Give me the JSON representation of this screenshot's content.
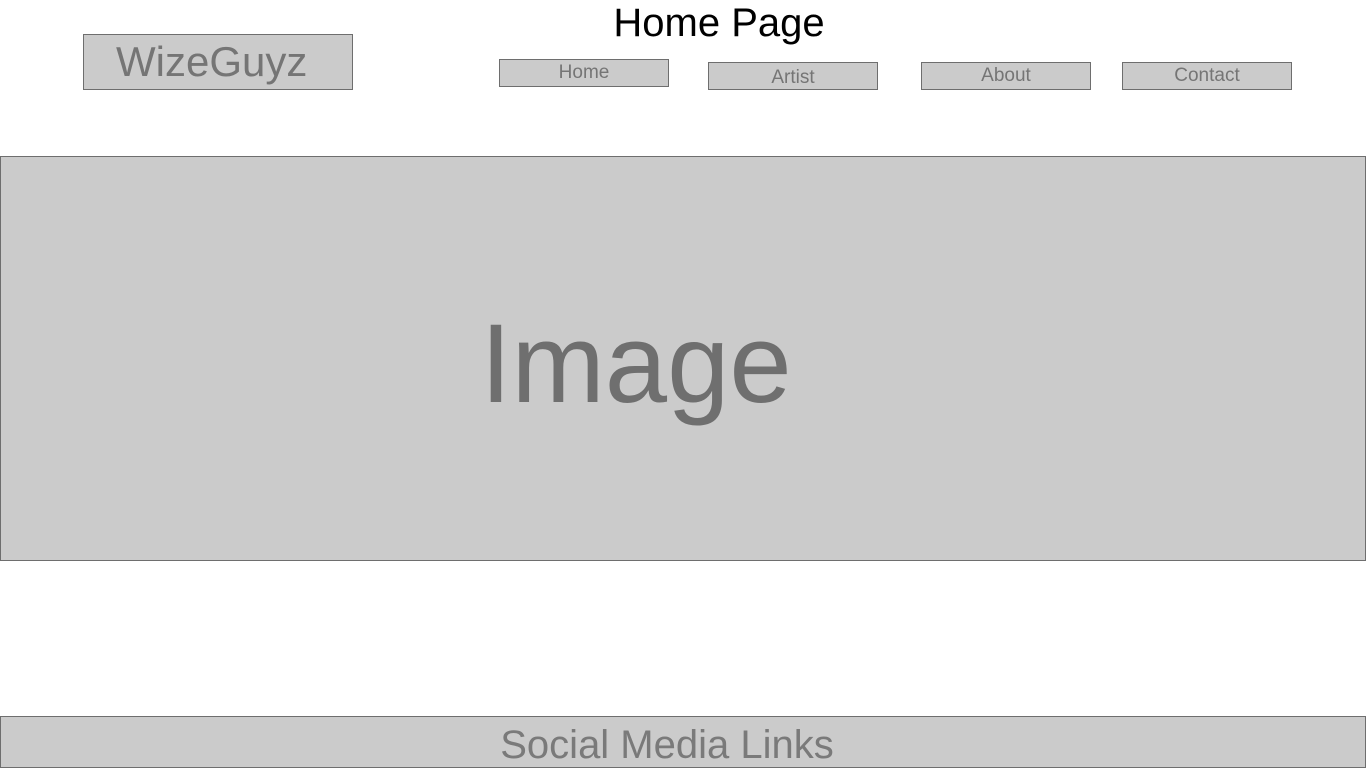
{
  "header": {
    "page_title": "Home Page",
    "logo_text": "WizeGuyz"
  },
  "nav": {
    "items": [
      {
        "label": "Home"
      },
      {
        "label": "Artist"
      },
      {
        "label": "About"
      },
      {
        "label": "Contact"
      }
    ]
  },
  "hero": {
    "placeholder_text": "Image"
  },
  "footer": {
    "social_text": "Social Media Links"
  },
  "colors": {
    "placeholder_fill": "#cbcbcb",
    "placeholder_border": "#6e6e6e",
    "placeholder_text": "#757575",
    "title_text": "#000000"
  }
}
